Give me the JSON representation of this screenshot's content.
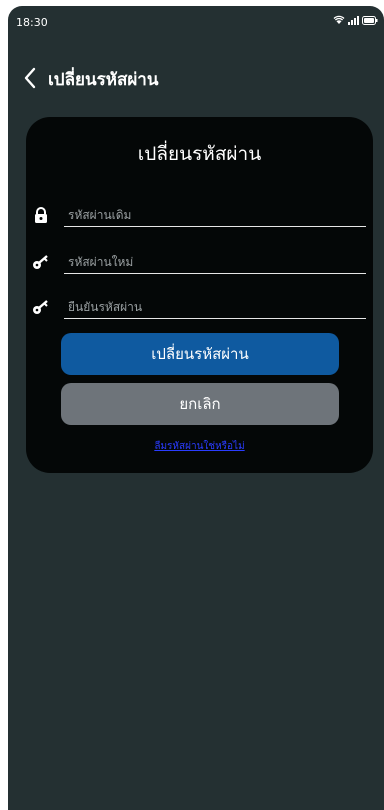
{
  "status": {
    "time": "18:30"
  },
  "appbar": {
    "title": "เปลี่ยนรหัสผ่าน"
  },
  "card": {
    "title": "เปลี่ยนรหัสผ่าน",
    "fields": {
      "current_password": {
        "placeholder": "รหัสผ่านเดิม",
        "icon": "lock-icon"
      },
      "new_password": {
        "placeholder": "รหัสผ่านใหม่",
        "icon": "key-icon"
      },
      "confirm_password": {
        "placeholder": "ยืนยันรหัสผ่าน",
        "icon": "key-icon"
      }
    },
    "buttons": {
      "submit": "เปลี่ยนรหัสผ่าน",
      "cancel": "ยกเลิก"
    },
    "forgot_link": "ลืมรหัสผ่านใช่หรือไม่"
  },
  "colors": {
    "background": "#243032",
    "card": "#040707",
    "primary": "#0f5aa0",
    "secondary": "#6e747a",
    "link": "#2a3cff"
  }
}
